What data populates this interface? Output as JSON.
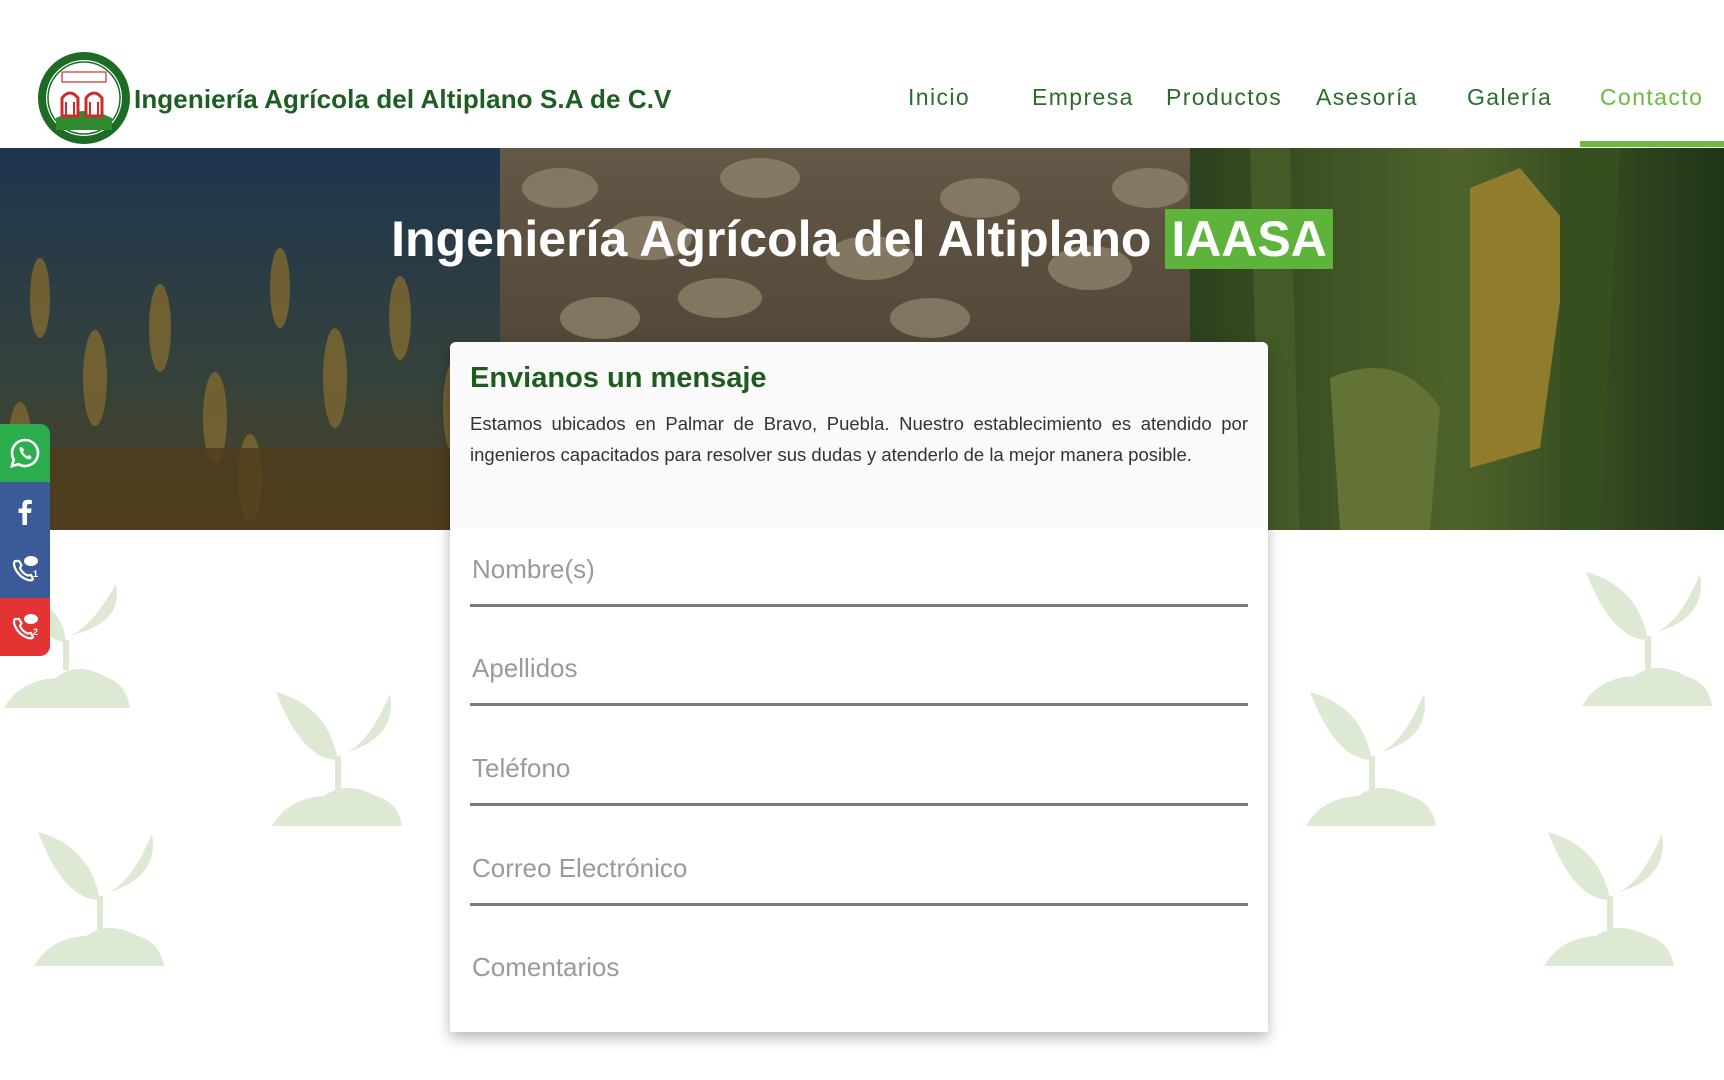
{
  "brand": {
    "name": "Ingeniería Agrícola del Altiplano S.A de C.V",
    "logo_icon": "iaasa-seal-logo"
  },
  "nav": {
    "items": [
      {
        "label": "Inicio"
      },
      {
        "label": "Empresa"
      },
      {
        "label": "Productos"
      },
      {
        "label": "Asesoría"
      },
      {
        "label": "Galería"
      },
      {
        "label": "Contacto",
        "active": true
      }
    ]
  },
  "hero": {
    "title": "Ingeniería Agrícola del Altiplano",
    "highlight": "IAASA"
  },
  "contact_card": {
    "title": "Envianos un mensaje",
    "description": "Estamos ubicados en Palmar de Bravo, Puebla. Nuestro establecimiento es atendido por ingenieros capacitados para resolver sus dudas y atenderlo de la mejor manera posible.",
    "fields": [
      {
        "name": "nombre",
        "placeholder": "Nombre(s)",
        "value": ""
      },
      {
        "name": "apellidos",
        "placeholder": "Apellidos",
        "value": ""
      },
      {
        "name": "telefono",
        "placeholder": "Teléfono",
        "value": ""
      },
      {
        "name": "correo",
        "placeholder": "Correo Electrónico",
        "value": ""
      },
      {
        "name": "comentarios",
        "placeholder": "Comentarios",
        "value": ""
      }
    ]
  },
  "social": [
    {
      "icon": "whatsapp-icon",
      "color": "#2dae4e"
    },
    {
      "icon": "facebook-icon",
      "color": "#3b5a98"
    },
    {
      "icon": "phone-chat-1-icon",
      "color": "#3b5a98"
    },
    {
      "icon": "phone-chat-2-icon",
      "color": "#e43333"
    }
  ],
  "colors": {
    "brand_green": "#1d5e22",
    "accent_green": "#6abb3f",
    "highlight_green": "#5eb43a",
    "sprout_green": "#dde9d2"
  }
}
